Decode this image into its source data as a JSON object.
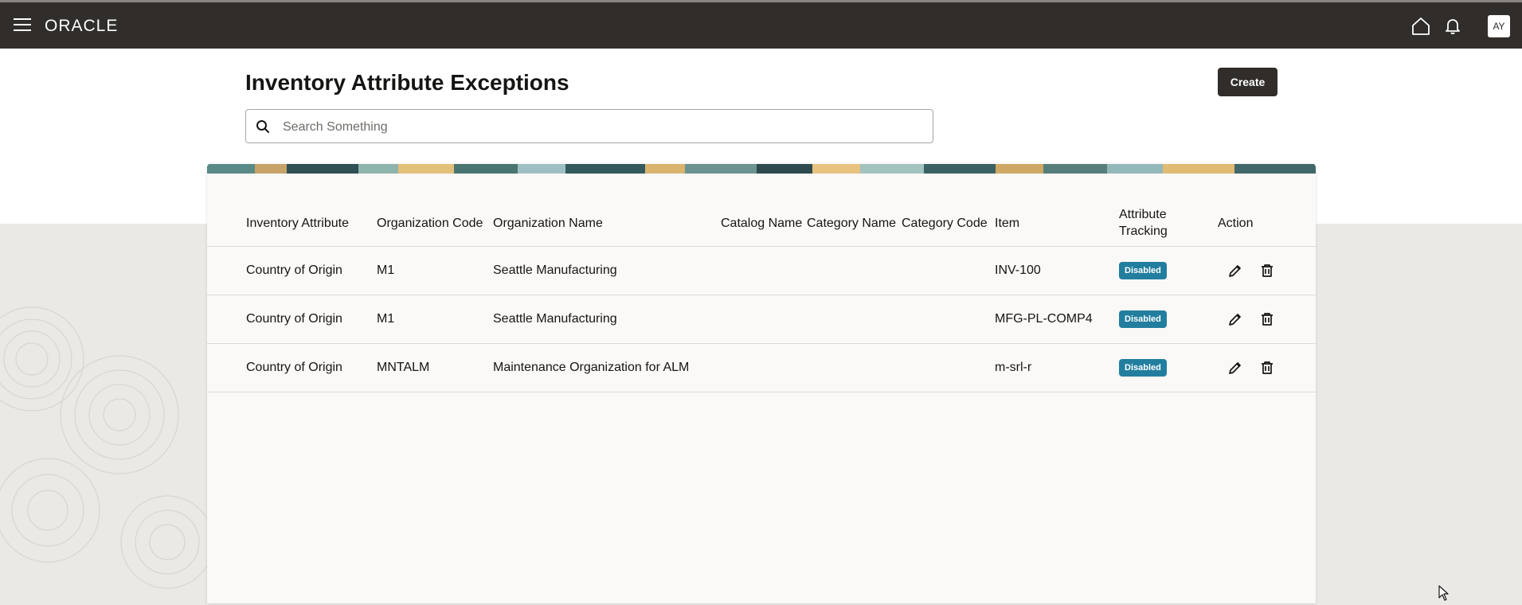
{
  "app": {
    "brand": "ORACLE",
    "avatar_initials": "AY"
  },
  "page": {
    "title": "Inventory Attribute Exceptions",
    "create_label": "Create"
  },
  "search": {
    "placeholder": "Search Something",
    "value": ""
  },
  "table": {
    "columns": [
      "Inventory Attribute",
      "Organization Code",
      "Organization Name",
      "Catalog Name",
      "Category Name",
      "Category Code",
      "Item",
      "Attribute Tracking",
      "Action"
    ],
    "rows": [
      {
        "inventory_attribute": "Country of Origin",
        "organization_code": "M1",
        "organization_name": "Seattle Manufacturing",
        "catalog_name": "",
        "category_name": "",
        "category_code": "",
        "item": "INV-100",
        "attribute_tracking": "Disabled"
      },
      {
        "inventory_attribute": "Country of Origin",
        "organization_code": "M1",
        "organization_name": "Seattle Manufacturing",
        "catalog_name": "",
        "category_name": "",
        "category_code": "",
        "item": "MFG-PL-COMP4",
        "attribute_tracking": "Disabled"
      },
      {
        "inventory_attribute": "Country of Origin",
        "organization_code": "MNTALM",
        "organization_name": "Maintenance Organization for ALM",
        "catalog_name": "",
        "category_name": "",
        "category_code": "",
        "item": "m-srl-r",
        "attribute_tracking": "Disabled"
      }
    ]
  },
  "colors": {
    "topbar": "#312d2a",
    "badge": "#227e9e",
    "card": "#fbf9f8"
  },
  "icons": [
    "menu-icon",
    "home-icon",
    "bell-icon",
    "search-icon",
    "edit-icon",
    "delete-icon"
  ]
}
